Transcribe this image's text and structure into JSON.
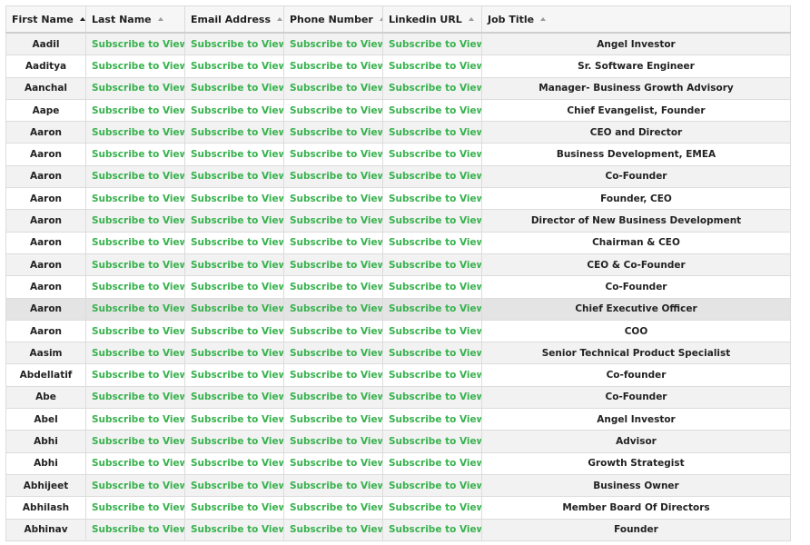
{
  "columns": [
    {
      "label": "First Name",
      "sort_icon": "sort-asc-icon",
      "active": true
    },
    {
      "label": "Last Name",
      "sort_icon": "sort-asc-icon",
      "active": false
    },
    {
      "label": "Email Address",
      "sort_icon": "sort-asc-icon",
      "active": false
    },
    {
      "label": "Phone Number",
      "sort_icon": "sort-asc-icon",
      "active": false
    },
    {
      "label": "Linkedin URL",
      "sort_icon": "sort-asc-icon",
      "active": false
    },
    {
      "label": "Job Title",
      "sort_icon": "sort-asc-icon",
      "active": false
    }
  ],
  "locked_text": "Subscribe to View",
  "colors": {
    "link_green": "#37b24d",
    "row_alt": "#f2f2f2",
    "row_highlight": "#e4e4e4"
  },
  "rows": [
    {
      "first_name": "Aadil",
      "job_title": "Angel Investor"
    },
    {
      "first_name": "Aaditya",
      "job_title": "Sr. Software Engineer"
    },
    {
      "first_name": "Aanchal",
      "job_title": "Manager- Business Growth Advisory"
    },
    {
      "first_name": "Aape",
      "job_title": "Chief Evangelist, Founder"
    },
    {
      "first_name": "Aaron",
      "job_title": "CEO and Director"
    },
    {
      "first_name": "Aaron",
      "job_title": "Business Development, EMEA"
    },
    {
      "first_name": "Aaron",
      "job_title": "Co-Founder"
    },
    {
      "first_name": "Aaron",
      "job_title": "Founder, CEO"
    },
    {
      "first_name": "Aaron",
      "job_title": "Director of New Business Development"
    },
    {
      "first_name": "Aaron",
      "job_title": "Chairman & CEO"
    },
    {
      "first_name": "Aaron",
      "job_title": "CEO & Co-Founder"
    },
    {
      "first_name": "Aaron",
      "job_title": "Co-Founder"
    },
    {
      "first_name": "Aaron",
      "job_title": "Chief Executive Officer",
      "highlighted": true
    },
    {
      "first_name": "Aaron",
      "job_title": "COO"
    },
    {
      "first_name": "Aasim",
      "job_title": "Senior Technical Product Specialist"
    },
    {
      "first_name": "Abdellatif",
      "job_title": "Co-founder"
    },
    {
      "first_name": "Abe",
      "job_title": "Co-Founder"
    },
    {
      "first_name": "Abel",
      "job_title": "Angel Investor"
    },
    {
      "first_name": "Abhi",
      "job_title": "Advisor"
    },
    {
      "first_name": "Abhi",
      "job_title": "Growth Strategist"
    },
    {
      "first_name": "Abhijeet",
      "job_title": "Business Owner"
    },
    {
      "first_name": "Abhilash",
      "job_title": "Member Board Of Directors"
    },
    {
      "first_name": "Abhinav",
      "job_title": "Founder"
    }
  ]
}
